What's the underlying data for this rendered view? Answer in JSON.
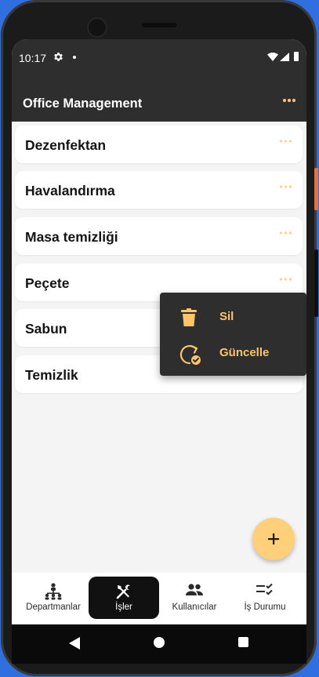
{
  "status_bar": {
    "time": "10:17"
  },
  "app_bar": {
    "title": "Office Management"
  },
  "tasks": [
    {
      "label": "Dezenfektan"
    },
    {
      "label": "Havalandırma"
    },
    {
      "label": "Masa temizliği"
    },
    {
      "label": "Peçete"
    },
    {
      "label": "Sabun"
    },
    {
      "label": "Temizlik"
    }
  ],
  "context_menu": {
    "items": [
      {
        "label": "Sil",
        "icon": "trash-icon"
      },
      {
        "label": "Güncelle",
        "icon": "refresh-check-icon"
      }
    ]
  },
  "fab": {
    "icon": "plus-icon"
  },
  "bottom_nav": {
    "items": [
      {
        "label": "Departmanlar",
        "icon": "org-chart-icon"
      },
      {
        "label": "İşler",
        "icon": "tools-icon",
        "active": true
      },
      {
        "label": "Kullanıcılar",
        "icon": "users-icon"
      },
      {
        "label": "İş Durumu",
        "icon": "checklist-icon"
      }
    ]
  },
  "colors": {
    "accent": "#ffc46b",
    "fab": "#ffcf7a",
    "app_bar": "#2e2e2e",
    "background": "#f4f4f4",
    "active_nav": "#111111"
  }
}
